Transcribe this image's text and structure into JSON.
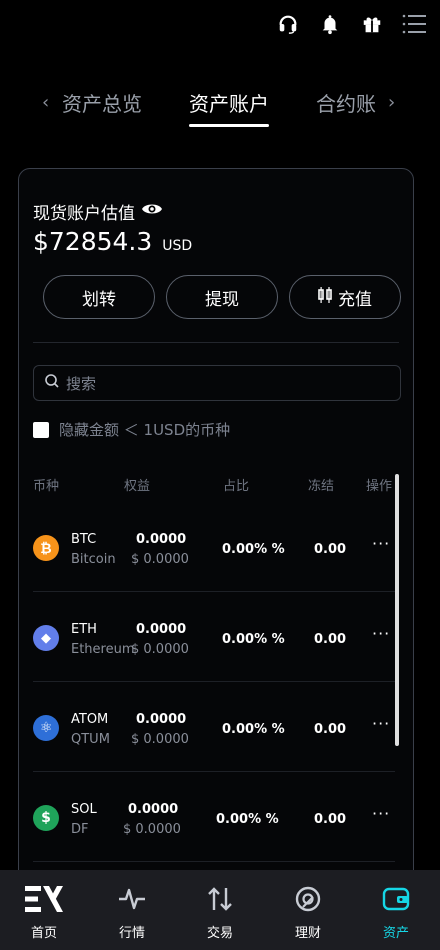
{
  "top_icons": [
    "headset-icon",
    "bell-icon",
    "gift-icon",
    "menu-icon"
  ],
  "tabs": {
    "prev": "资产总览",
    "current": "资产账户",
    "next": "合约账"
  },
  "account": {
    "label": "现货账户估值",
    "value": "$72854.3",
    "currency": "USD"
  },
  "actions": {
    "transfer": "划转",
    "withdraw": "提现",
    "deposit": "充值"
  },
  "search": {
    "placeholder": "搜索"
  },
  "hide_small": {
    "label": "隐藏金额 ＜ 1USD的币种",
    "checked": false
  },
  "columns": {
    "coin": "币种",
    "equity": "权益",
    "ratio": "占比",
    "frozen": "冻结",
    "action": "操作"
  },
  "assets": [
    {
      "symbol": "BTC",
      "name": "Bitcoin",
      "equity": "0.0000",
      "equity_usd": "$ 0.0000",
      "ratio": "0.00% %",
      "frozen": "0.00",
      "more": "···",
      "icon": "bitcoin-icon",
      "color": "#f7931a",
      "glyph": "₿"
    },
    {
      "symbol": "ETH",
      "name": "Ethereum",
      "equity": "0.0000",
      "equity_usd": "$ 0.0000",
      "ratio": "0.00% %",
      "frozen": "0.00",
      "more": "···",
      "icon": "ethereum-icon",
      "color": "#627eea",
      "glyph": "◆"
    },
    {
      "symbol": "ATOM",
      "name": "QTUM",
      "equity": "0.0000",
      "equity_usd": "$ 0.0000",
      "ratio": "0.00% %",
      "frozen": "0.00",
      "more": "···",
      "icon": "atom-icon",
      "color": "#2e6fd8",
      "glyph": "⚛"
    },
    {
      "symbol": "SOL",
      "name": "DF",
      "equity": "0.0000",
      "equity_usd": "$ 0.0000",
      "ratio": "0.00% %",
      "frozen": "0.00",
      "more": "···",
      "icon": "dollar-coin-icon",
      "color": "#1fa35a",
      "glyph": "$"
    }
  ],
  "nav": [
    {
      "label": "首页",
      "icon": "home-logo-icon",
      "active": false
    },
    {
      "label": "行情",
      "icon": "market-pulse-icon",
      "active": false
    },
    {
      "label": "交易",
      "icon": "trade-arrows-icon",
      "active": false
    },
    {
      "label": "理财",
      "icon": "finance-icon",
      "active": false
    },
    {
      "label": "资产",
      "icon": "wallet-icon",
      "active": true
    }
  ],
  "colors": {
    "accent": "#16d7e6",
    "background": "#000000",
    "nav_bg": "#1c1d22"
  }
}
